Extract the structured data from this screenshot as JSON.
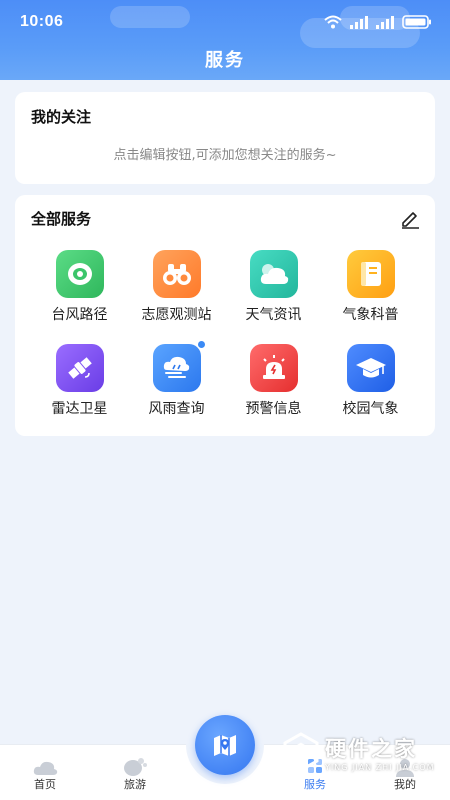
{
  "status_bar": {
    "time": "10:06"
  },
  "header": {
    "title": "服务"
  },
  "my_focus": {
    "title": "我的关注",
    "hint": "点击编辑按钮,可添加您想关注的服务~"
  },
  "all_services": {
    "title": "全部服务",
    "items": [
      {
        "label": "台风路径",
        "icon": "typhoon-icon",
        "color": "#3cc56b"
      },
      {
        "label": "志愿观测站",
        "icon": "binoculars-icon",
        "color": "#ff8a3d"
      },
      {
        "label": "天气资讯",
        "icon": "weather-cloud-icon",
        "color": "#2ec9b0"
      },
      {
        "label": "气象科普",
        "icon": "book-icon",
        "color": "#ffb21f"
      },
      {
        "label": "雷达卫星",
        "icon": "satellite-icon",
        "color": "#7b4df0"
      },
      {
        "label": "风雨查询",
        "icon": "wind-rain-icon",
        "color": "#3b8af5"
      },
      {
        "label": "预警信息",
        "icon": "alarm-icon",
        "color": "#f24a4a"
      },
      {
        "label": "校园气象",
        "icon": "graduation-cap-icon",
        "color": "#2f6ff0"
      }
    ]
  },
  "bottom_nav": {
    "items": [
      {
        "label": "首页",
        "icon": "home-cloud-icon"
      },
      {
        "label": "旅游",
        "icon": "travel-icon"
      },
      {
        "label": "服务",
        "icon": "service-icon",
        "active": true
      },
      {
        "label": "我的",
        "icon": "profile-icon"
      }
    ],
    "center_button_icon": "map-icon"
  },
  "watermark": {
    "main": "硬件之家",
    "sub": "YING JIAN ZHI JIA.COM"
  }
}
